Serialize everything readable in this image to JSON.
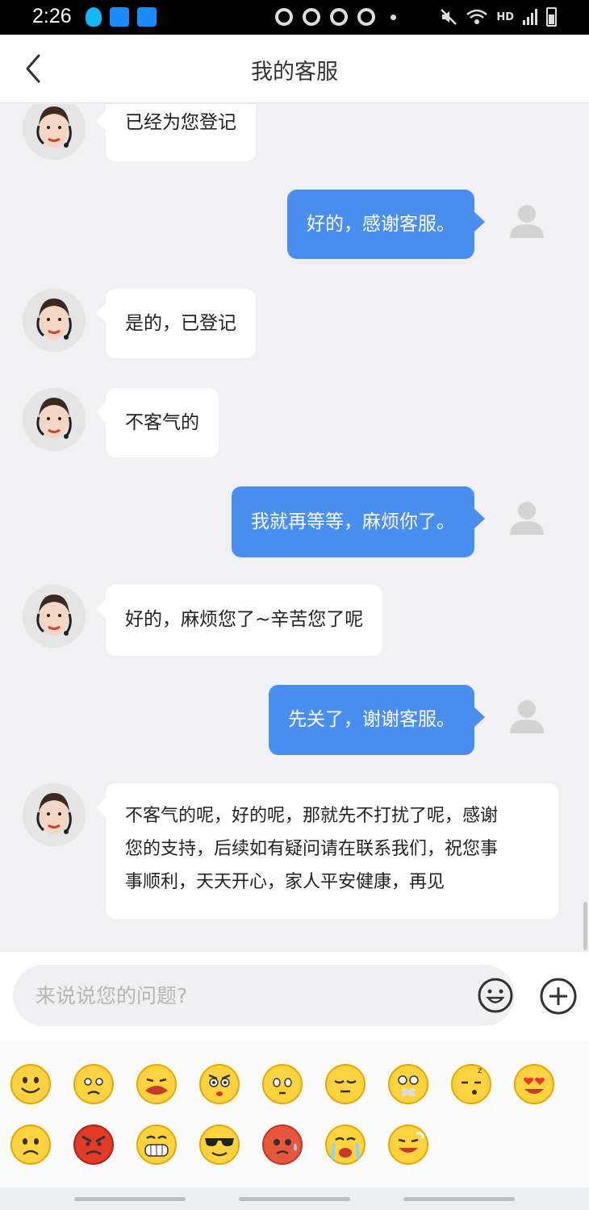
{
  "status_bar": {
    "time": "2:26",
    "network": "HD"
  },
  "header": {
    "title": "我的客服"
  },
  "messages": [
    {
      "from": "agent",
      "text": "已经为您登记"
    },
    {
      "from": "user",
      "text": "好的，感谢客服。"
    },
    {
      "from": "agent",
      "text": "是的，已登记"
    },
    {
      "from": "agent",
      "text": "不客气的"
    },
    {
      "from": "user",
      "text": "我就再等等，麻烦你了。"
    },
    {
      "from": "agent",
      "text": "好的，麻烦您了~辛苦您了呢"
    },
    {
      "from": "user",
      "text": "先关了，谢谢客服。"
    },
    {
      "from": "agent",
      "text": "不客气的呢，好的呢，那就先不打扰了呢，感谢\n您的支持，后续如有疑问请在联系我们，祝您事\n事顺利，天天开心，家人平安健康，再见"
    }
  ],
  "input": {
    "placeholder": "来说说您的问题?"
  },
  "emojis": [
    "smile",
    "wronged",
    "crying-loud",
    "angry-stare",
    "shy",
    "speechless",
    "dizzy-mouth-sealed",
    "sleepy",
    "heart-eyes",
    "sad",
    "furious",
    "grin",
    "cool-sunglasses",
    "embarrassed-sweat",
    "sob",
    "laughing"
  ],
  "colors": {
    "user_bubble": "#4a8ef0",
    "agent_bubble": "#ffffff",
    "background": "#f1f1f3"
  }
}
